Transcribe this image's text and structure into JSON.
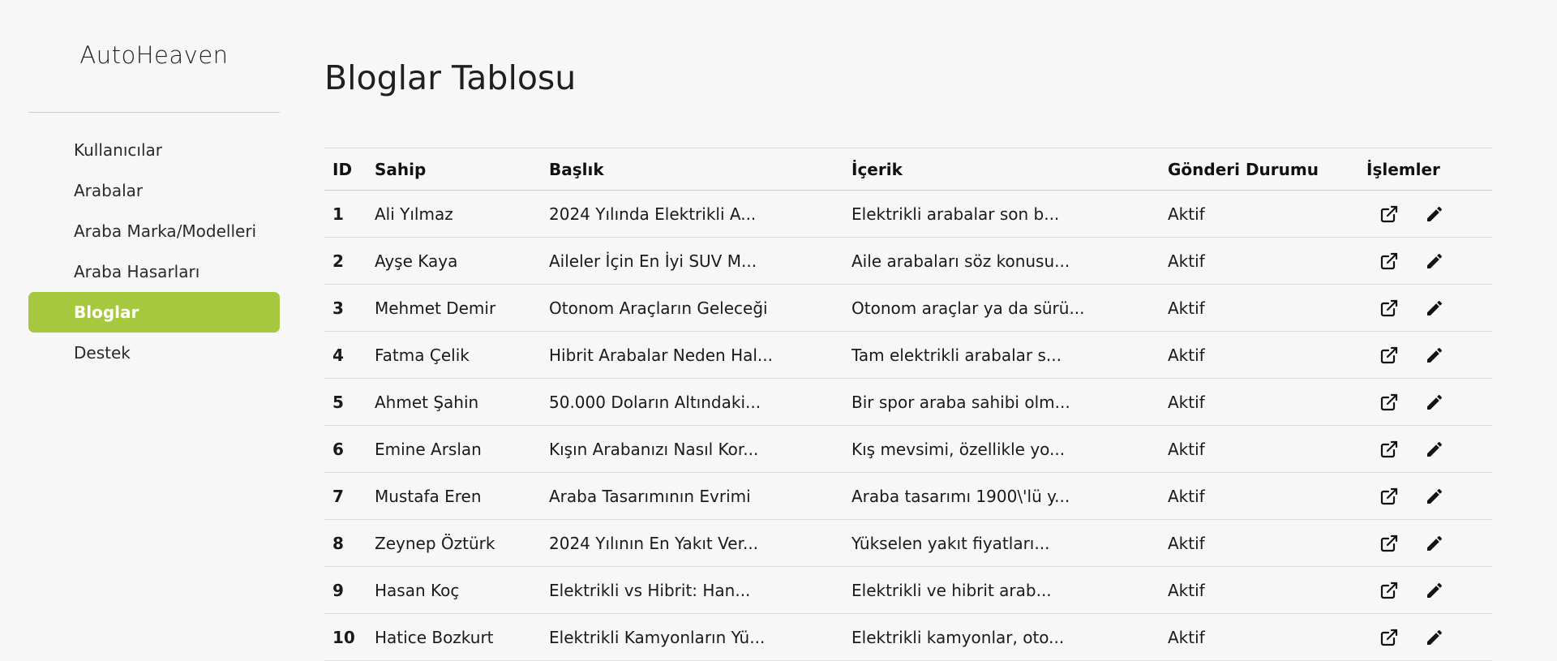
{
  "sidebar": {
    "brand": "AutoHeaven",
    "items": [
      {
        "label": "Kullanıcılar",
        "active": false
      },
      {
        "label": "Arabalar",
        "active": false
      },
      {
        "label": "Araba Marka/Modelleri",
        "active": false
      },
      {
        "label": "Araba Hasarları",
        "active": false
      },
      {
        "label": "Bloglar",
        "active": true
      },
      {
        "label": "Destek",
        "active": false
      }
    ]
  },
  "main": {
    "title": "Bloglar Tablosu",
    "table": {
      "headers": {
        "id": "ID",
        "owner": "Sahip",
        "title": "Başlık",
        "content": "İçerik",
        "status": "Gönderi Durumu",
        "actions": "İşlemler"
      },
      "rows": [
        {
          "id": "1",
          "owner": "Ali Yılmaz",
          "title": "2024 Yılında Elektrikli A...",
          "content": "Elektrikli arabalar son b...",
          "status": "Aktif"
        },
        {
          "id": "2",
          "owner": "Ayşe Kaya",
          "title": "Aileler İçin En İyi SUV M...",
          "content": "Aile arabaları söz konusu...",
          "status": "Aktif"
        },
        {
          "id": "3",
          "owner": "Mehmet Demir",
          "title": "Otonom Araçların Geleceği",
          "content": "Otonom araçlar ya da sürü...",
          "status": "Aktif"
        },
        {
          "id": "4",
          "owner": "Fatma Çelik",
          "title": "Hibrit Arabalar Neden Hal...",
          "content": "Tam elektrikli arabalar s...",
          "status": "Aktif"
        },
        {
          "id": "5",
          "owner": "Ahmet Şahin",
          "title": "50.000 Doların Altındaki...",
          "content": "Bir spor araba sahibi olm...",
          "status": "Aktif"
        },
        {
          "id": "6",
          "owner": "Emine Arslan",
          "title": "Kışın Arabanızı Nasıl Kor...",
          "content": "Kış mevsimi, özellikle yo...",
          "status": "Aktif"
        },
        {
          "id": "7",
          "owner": "Mustafa Eren",
          "title": "Araba Tasarımının Evrimi",
          "content": "Araba tasarımı 1900\\'lü y...",
          "status": "Aktif"
        },
        {
          "id": "8",
          "owner": "Zeynep Öztürk",
          "title": "2024 Yılının En Yakıt Ver...",
          "content": "Yükselen yakıt fiyatları...",
          "status": "Aktif"
        },
        {
          "id": "9",
          "owner": "Hasan Koç",
          "title": "Elektrikli vs Hibrit: Han...",
          "content": "Elektrikli ve hibrit arab...",
          "status": "Aktif"
        },
        {
          "id": "10",
          "owner": "Hatice Bozkurt",
          "title": "Elektrikli Kamyonların Yü...",
          "content": "Elektrikli kamyonlar, oto...",
          "status": "Aktif"
        }
      ],
      "action_icons": [
        "external-link-icon",
        "pencil-icon"
      ]
    }
  },
  "colors": {
    "background": "#f7f7f7",
    "accent": "#a6c83e"
  }
}
